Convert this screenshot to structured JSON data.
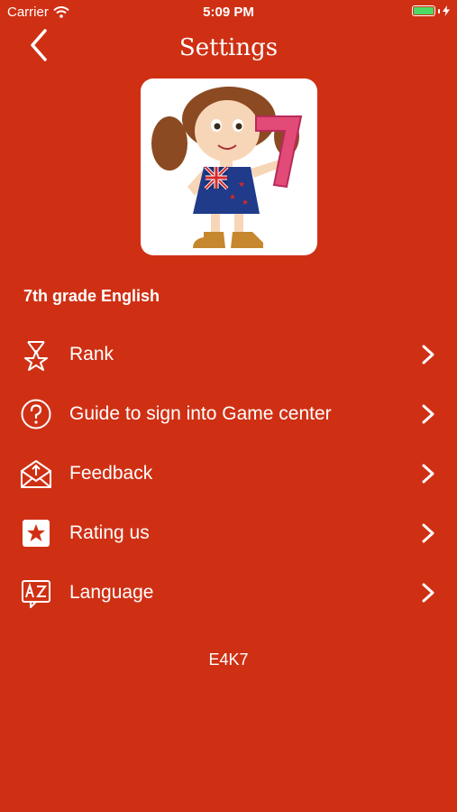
{
  "status_bar": {
    "carrier": "Carrier",
    "time": "5:09 PM",
    "battery_color": "#4cd964"
  },
  "nav": {
    "title": "Settings",
    "back_icon": "chevron-left-icon"
  },
  "app": {
    "subtitle": "7th grade English"
  },
  "menu": [
    {
      "label": "Rank",
      "icon": "hourglass-star-icon"
    },
    {
      "label": "Guide to sign into Game center",
      "icon": "question-circle-icon"
    },
    {
      "label": "Feedback",
      "icon": "envelope-icon"
    },
    {
      "label": "Rating us",
      "icon": "star-box-icon"
    },
    {
      "label": "Language",
      "icon": "translate-icon"
    }
  ],
  "footer": {
    "code": "E4K7"
  },
  "colors": {
    "background": "#cf3014",
    "text": "#ffffff"
  }
}
